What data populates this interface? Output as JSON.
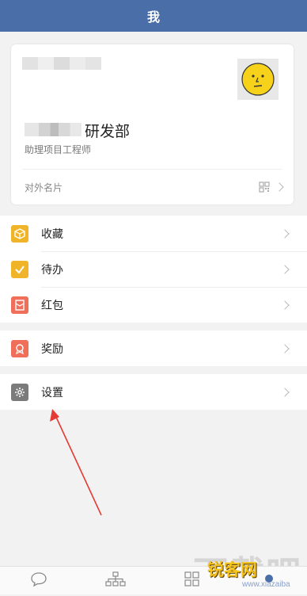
{
  "header": {
    "title": "我"
  },
  "profile": {
    "department_suffix": "研发部",
    "job_title": "助理项目工程师",
    "external_card_label": "对外名片"
  },
  "menu_group_1": [
    {
      "label": "收藏",
      "icon": "box-icon",
      "color": "#f0b429"
    },
    {
      "label": "待办",
      "icon": "check-icon",
      "color": "#f0b429"
    },
    {
      "label": "红包",
      "icon": "red-envelope-icon",
      "color": "#ef6f5a"
    }
  ],
  "menu_group_2": [
    {
      "label": "奖励",
      "icon": "award-icon",
      "color": "#ef6f5a"
    }
  ],
  "menu_group_3": [
    {
      "label": "设置",
      "icon": "gear-icon",
      "color": "#7b7b7b"
    }
  ],
  "watermark": {
    "site": "锐客网",
    "url": "www.xiazaiba",
    "bg_text": "下载吧"
  },
  "colors": {
    "header": "#4a6fa8",
    "annotation_arrow": "#e53935"
  }
}
